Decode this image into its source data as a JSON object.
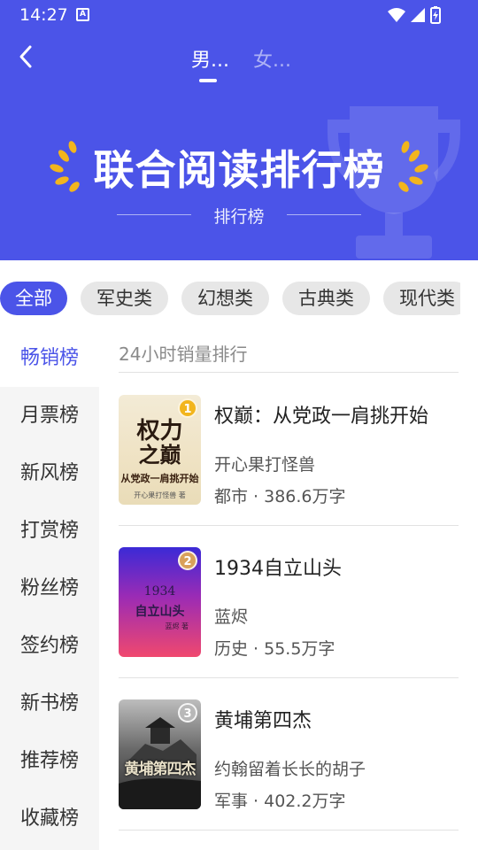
{
  "status_bar": {
    "time": "14:27",
    "a_badge": "A"
  },
  "nav": {
    "back_icon": "chevron-left-icon",
    "tab_male": "男...",
    "tab_female": "女..."
  },
  "banner": {
    "title": "联合阅读排行榜",
    "subtitle": "排行榜"
  },
  "categories": [
    "全部",
    "军史类",
    "幻想类",
    "古典类",
    "现代类"
  ],
  "sidebar": [
    "畅销榜",
    "月票榜",
    "新风榜",
    "打赏榜",
    "粉丝榜",
    "签约榜",
    "新书榜",
    "推荐榜",
    "收藏榜"
  ],
  "list_header": "24小时销量排行",
  "books": [
    {
      "rank": "1",
      "title": "权巅：从党政一肩挑开始",
      "author": "开心果打怪兽",
      "meta": "都市 · 386.6万字",
      "cover_title_1": "权力",
      "cover_title_2": "之巅",
      "cover_sub": "从党政一肩挑开始",
      "cover_author": "开心果打怪兽 著"
    },
    {
      "rank": "2",
      "title": "1934自立山头",
      "author": "蓝烬",
      "meta": "历史 · 55.5万字",
      "cover_title_1": "1934",
      "cover_title_2": "自立山头",
      "cover_author": "蓝烬 著"
    },
    {
      "rank": "3",
      "title": "黄埔第四杰",
      "author": "约翰留着长长的胡子",
      "meta": "军事 · 402.2万字",
      "cover_title_1": "黄埔第四杰"
    }
  ],
  "colors": {
    "primary": "#4b54e8",
    "gold": "#f2b51d",
    "silver": "#b8b8b8",
    "bronze": "#d9a15a"
  }
}
